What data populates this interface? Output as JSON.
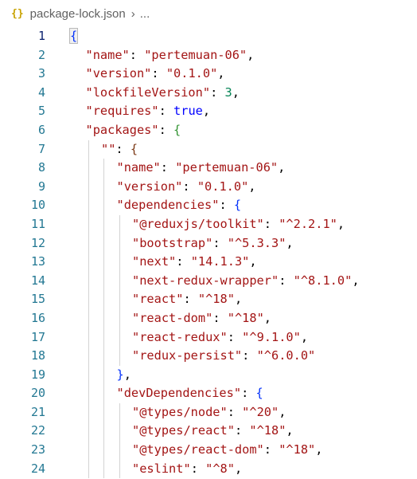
{
  "breadcrumb": {
    "icon": "{}",
    "file": "package-lock.json",
    "separator": "›",
    "more": "..."
  },
  "lines": [
    {
      "num": "1",
      "indent": 0,
      "active_guides": [],
      "tokens": [
        [
          "br0 bracket-hl",
          "{"
        ]
      ],
      "current": true
    },
    {
      "num": "2",
      "indent": 1,
      "tokens": [
        [
          "k",
          "\"name\""
        ],
        [
          "p",
          ": "
        ],
        [
          "s",
          "\"pertemuan-06\""
        ],
        [
          "p",
          ","
        ]
      ]
    },
    {
      "num": "3",
      "indent": 1,
      "tokens": [
        [
          "k",
          "\"version\""
        ],
        [
          "p",
          ": "
        ],
        [
          "s",
          "\"0.1.0\""
        ],
        [
          "p",
          ","
        ]
      ]
    },
    {
      "num": "4",
      "indent": 1,
      "tokens": [
        [
          "k",
          "\"lockfileVersion\""
        ],
        [
          "p",
          ": "
        ],
        [
          "n",
          "3"
        ],
        [
          "p",
          ","
        ]
      ]
    },
    {
      "num": "5",
      "indent": 1,
      "tokens": [
        [
          "k",
          "\"requires\""
        ],
        [
          "p",
          ": "
        ],
        [
          "b",
          "true"
        ],
        [
          "p",
          ","
        ]
      ]
    },
    {
      "num": "6",
      "indent": 1,
      "tokens": [
        [
          "k",
          "\"packages\""
        ],
        [
          "p",
          ": "
        ],
        [
          "br1",
          "{"
        ]
      ]
    },
    {
      "num": "7",
      "indent": 2,
      "tokens": [
        [
          "k",
          "\"\""
        ],
        [
          "p",
          ": "
        ],
        [
          "br2",
          "{"
        ]
      ]
    },
    {
      "num": "8",
      "indent": 3,
      "tokens": [
        [
          "k",
          "\"name\""
        ],
        [
          "p",
          ": "
        ],
        [
          "s",
          "\"pertemuan-06\""
        ],
        [
          "p",
          ","
        ]
      ]
    },
    {
      "num": "9",
      "indent": 3,
      "tokens": [
        [
          "k",
          "\"version\""
        ],
        [
          "p",
          ": "
        ],
        [
          "s",
          "\"0.1.0\""
        ],
        [
          "p",
          ","
        ]
      ]
    },
    {
      "num": "10",
      "indent": 3,
      "tokens": [
        [
          "k",
          "\"dependencies\""
        ],
        [
          "p",
          ": "
        ],
        [
          "br0",
          "{"
        ]
      ]
    },
    {
      "num": "11",
      "indent": 4,
      "tokens": [
        [
          "k",
          "\"@reduxjs/toolkit\""
        ],
        [
          "p",
          ": "
        ],
        [
          "s",
          "\"^2.2.1\""
        ],
        [
          "p",
          ","
        ]
      ]
    },
    {
      "num": "12",
      "indent": 4,
      "tokens": [
        [
          "k",
          "\"bootstrap\""
        ],
        [
          "p",
          ": "
        ],
        [
          "s",
          "\"^5.3.3\""
        ],
        [
          "p",
          ","
        ]
      ]
    },
    {
      "num": "13",
      "indent": 4,
      "tokens": [
        [
          "k",
          "\"next\""
        ],
        [
          "p",
          ": "
        ],
        [
          "s",
          "\"14.1.3\""
        ],
        [
          "p",
          ","
        ]
      ]
    },
    {
      "num": "14",
      "indent": 4,
      "tokens": [
        [
          "k",
          "\"next-redux-wrapper\""
        ],
        [
          "p",
          ": "
        ],
        [
          "s",
          "\"^8.1.0\""
        ],
        [
          "p",
          ","
        ]
      ]
    },
    {
      "num": "15",
      "indent": 4,
      "tokens": [
        [
          "k",
          "\"react\""
        ],
        [
          "p",
          ": "
        ],
        [
          "s",
          "\"^18\""
        ],
        [
          "p",
          ","
        ]
      ]
    },
    {
      "num": "16",
      "indent": 4,
      "tokens": [
        [
          "k",
          "\"react-dom\""
        ],
        [
          "p",
          ": "
        ],
        [
          "s",
          "\"^18\""
        ],
        [
          "p",
          ","
        ]
      ]
    },
    {
      "num": "17",
      "indent": 4,
      "tokens": [
        [
          "k",
          "\"react-redux\""
        ],
        [
          "p",
          ": "
        ],
        [
          "s",
          "\"^9.1.0\""
        ],
        [
          "p",
          ","
        ]
      ]
    },
    {
      "num": "18",
      "indent": 4,
      "tokens": [
        [
          "k",
          "\"redux-persist\""
        ],
        [
          "p",
          ": "
        ],
        [
          "s",
          "\"^6.0.0\""
        ]
      ]
    },
    {
      "num": "19",
      "indent": 3,
      "tokens": [
        [
          "br0",
          "}"
        ],
        [
          "p",
          ","
        ]
      ]
    },
    {
      "num": "20",
      "indent": 3,
      "tokens": [
        [
          "k",
          "\"devDependencies\""
        ],
        [
          "p",
          ": "
        ],
        [
          "br0",
          "{"
        ]
      ]
    },
    {
      "num": "21",
      "indent": 4,
      "tokens": [
        [
          "k",
          "\"@types/node\""
        ],
        [
          "p",
          ": "
        ],
        [
          "s",
          "\"^20\""
        ],
        [
          "p",
          ","
        ]
      ]
    },
    {
      "num": "22",
      "indent": 4,
      "tokens": [
        [
          "k",
          "\"@types/react\""
        ],
        [
          "p",
          ": "
        ],
        [
          "s",
          "\"^18\""
        ],
        [
          "p",
          ","
        ]
      ]
    },
    {
      "num": "23",
      "indent": 4,
      "tokens": [
        [
          "k",
          "\"@types/react-dom\""
        ],
        [
          "p",
          ": "
        ],
        [
          "s",
          "\"^18\""
        ],
        [
          "p",
          ","
        ]
      ]
    },
    {
      "num": "24",
      "indent": 4,
      "tokens": [
        [
          "k",
          "\"eslint\""
        ],
        [
          "p",
          ": "
        ],
        [
          "s",
          "\"^8\""
        ],
        [
          "p",
          ","
        ]
      ]
    }
  ]
}
